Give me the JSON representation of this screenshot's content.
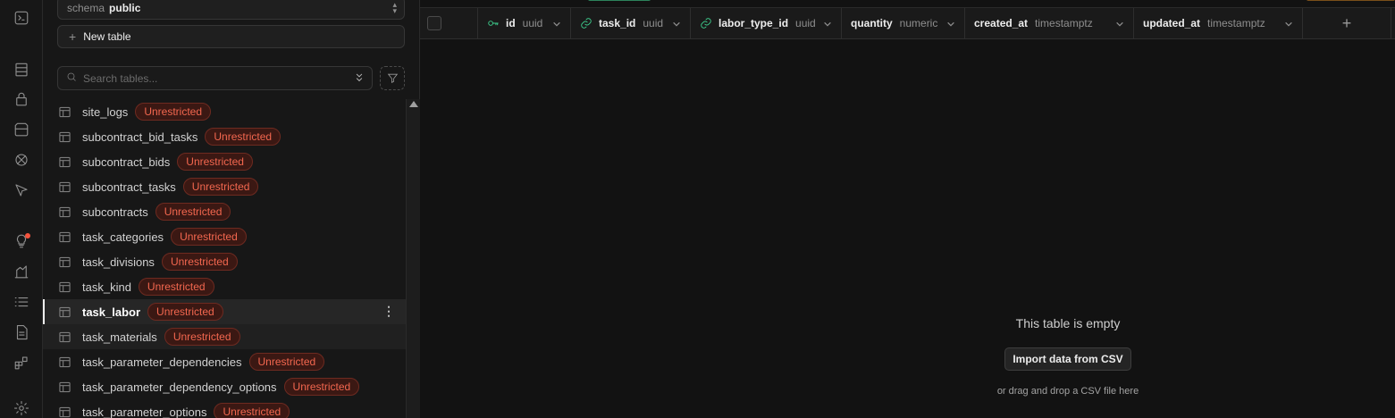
{
  "rail": {
    "icons": [
      "terminal-icon",
      "table-editor-icon",
      "lock-icon",
      "storage-icon",
      "realtime-icon",
      "pointer-icon",
      "advisor-icon",
      "reports-icon",
      "logs-icon",
      "docs-icon",
      "integrations-icon",
      "settings-icon"
    ]
  },
  "sidebar": {
    "schema_label": "schema",
    "schema_value": "public",
    "new_table_label": "New table",
    "search_placeholder": "Search tables...",
    "tables": [
      {
        "name": "site_logs",
        "badge": "Unrestricted"
      },
      {
        "name": "subcontract_bid_tasks",
        "badge": "Unrestricted"
      },
      {
        "name": "subcontract_bids",
        "badge": "Unrestricted"
      },
      {
        "name": "subcontract_tasks",
        "badge": "Unrestricted"
      },
      {
        "name": "subcontracts",
        "badge": "Unrestricted"
      },
      {
        "name": "task_categories",
        "badge": "Unrestricted"
      },
      {
        "name": "task_divisions",
        "badge": "Unrestricted"
      },
      {
        "name": "task_kind",
        "badge": "Unrestricted"
      },
      {
        "name": "task_labor",
        "badge": "Unrestricted"
      },
      {
        "name": "task_materials",
        "badge": "Unrestricted"
      },
      {
        "name": "task_parameter_dependencies",
        "badge": "Unrestricted"
      },
      {
        "name": "task_parameter_dependency_options",
        "badge": "Unrestricted"
      },
      {
        "name": "task_parameter_options",
        "badge": "Unrestricted"
      }
    ],
    "active_table": "task_labor"
  },
  "grid": {
    "columns": [
      {
        "name": "id",
        "type": "uuid",
        "icon": "key-icon"
      },
      {
        "name": "task_id",
        "type": "uuid",
        "icon": "link-icon"
      },
      {
        "name": "labor_type_id",
        "type": "uuid",
        "icon": "link-icon"
      },
      {
        "name": "quantity",
        "type": "numeric",
        "icon": ""
      },
      {
        "name": "created_at",
        "type": "timestamptz",
        "icon": ""
      },
      {
        "name": "updated_at",
        "type": "timestamptz",
        "icon": ""
      }
    ],
    "add_column_label": "+",
    "empty_title": "This table is empty",
    "import_label": "Import data from CSV",
    "empty_hint": "or drag and drop a CSV file here"
  },
  "colors": {
    "accent": "#3ecf8e",
    "badge_text": "#f3674f",
    "background": "#121212"
  }
}
